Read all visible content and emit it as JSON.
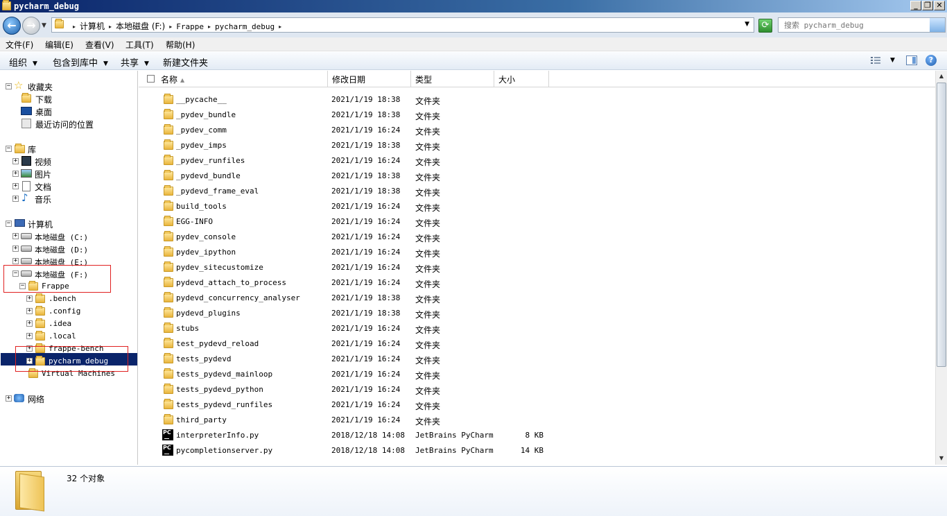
{
  "window": {
    "title": "pycharm_debug"
  },
  "address": {
    "crumbs": [
      "计算机",
      "本地磁盘 (F:)",
      "Frappe",
      "pycharm_debug"
    ],
    "search_placeholder": "搜索 pycharm_debug"
  },
  "menu": [
    "文件(F)",
    "编辑(E)",
    "查看(V)",
    "工具(T)",
    "帮助(H)"
  ],
  "toolbar": {
    "organize": "组织",
    "include": "包含到库中",
    "share": "共享",
    "new_folder": "新建文件夹"
  },
  "nav": {
    "favorites": "收藏夹",
    "downloads": "下载",
    "desktop": "桌面",
    "recent": "最近访问的位置",
    "libraries": "库",
    "videos": "视频",
    "pictures": "图片",
    "documents": "文档",
    "music": "音乐",
    "computer": "计算机",
    "drive_c": "本地磁盘 (C:)",
    "drive_d": "本地磁盘 (D:)",
    "drive_e": "本地磁盘 (E:)",
    "drive_f": "本地磁盘 (F:)",
    "frappe": "Frappe",
    "bench": ".bench",
    "config": ".config",
    "idea": ".idea",
    "local": ".local",
    "frappe_bench": "frappe-bench",
    "pycharm_debug": "pycharm_debug",
    "virtual_machines": "Virtual Machines",
    "network": "网络"
  },
  "columns": {
    "name": "名称",
    "modified": "修改日期",
    "type": "类型",
    "size": "大小"
  },
  "files": [
    {
      "name": "__pycache__",
      "date": "2021/1/19 18:38",
      "type": "文件夹",
      "size": ""
    },
    {
      "name": "_pydev_bundle",
      "date": "2021/1/19 18:38",
      "type": "文件夹",
      "size": ""
    },
    {
      "name": "_pydev_comm",
      "date": "2021/1/19 16:24",
      "type": "文件夹",
      "size": ""
    },
    {
      "name": "_pydev_imps",
      "date": "2021/1/19 18:38",
      "type": "文件夹",
      "size": ""
    },
    {
      "name": "_pydev_runfiles",
      "date": "2021/1/19 16:24",
      "type": "文件夹",
      "size": ""
    },
    {
      "name": "_pydevd_bundle",
      "date": "2021/1/19 18:38",
      "type": "文件夹",
      "size": ""
    },
    {
      "name": "_pydevd_frame_eval",
      "date": "2021/1/19 18:38",
      "type": "文件夹",
      "size": ""
    },
    {
      "name": "build_tools",
      "date": "2021/1/19 16:24",
      "type": "文件夹",
      "size": ""
    },
    {
      "name": "EGG-INFO",
      "date": "2021/1/19 16:24",
      "type": "文件夹",
      "size": ""
    },
    {
      "name": "pydev_console",
      "date": "2021/1/19 16:24",
      "type": "文件夹",
      "size": ""
    },
    {
      "name": "pydev_ipython",
      "date": "2021/1/19 16:24",
      "type": "文件夹",
      "size": ""
    },
    {
      "name": "pydev_sitecustomize",
      "date": "2021/1/19 16:24",
      "type": "文件夹",
      "size": ""
    },
    {
      "name": "pydevd_attach_to_process",
      "date": "2021/1/19 16:24",
      "type": "文件夹",
      "size": ""
    },
    {
      "name": "pydevd_concurrency_analyser",
      "date": "2021/1/19 18:38",
      "type": "文件夹",
      "size": ""
    },
    {
      "name": "pydevd_plugins",
      "date": "2021/1/19 18:38",
      "type": "文件夹",
      "size": ""
    },
    {
      "name": "stubs",
      "date": "2021/1/19 16:24",
      "type": "文件夹",
      "size": ""
    },
    {
      "name": "test_pydevd_reload",
      "date": "2021/1/19 16:24",
      "type": "文件夹",
      "size": ""
    },
    {
      "name": "tests_pydevd",
      "date": "2021/1/19 16:24",
      "type": "文件夹",
      "size": ""
    },
    {
      "name": "tests_pydevd_mainloop",
      "date": "2021/1/19 16:24",
      "type": "文件夹",
      "size": ""
    },
    {
      "name": "tests_pydevd_python",
      "date": "2021/1/19 16:24",
      "type": "文件夹",
      "size": ""
    },
    {
      "name": "tests_pydevd_runfiles",
      "date": "2021/1/19 16:24",
      "type": "文件夹",
      "size": ""
    },
    {
      "name": "third_party",
      "date": "2021/1/19 16:24",
      "type": "文件夹",
      "size": ""
    },
    {
      "name": "interpreterInfo.py",
      "date": "2018/12/18 14:08",
      "type": "JetBrains PyCharm",
      "size": "8 KB"
    },
    {
      "name": "pycompletionserver.py",
      "date": "2018/12/18 14:08",
      "type": "JetBrains PyCharm",
      "size": "14 KB"
    }
  ],
  "status": {
    "count": "32 个对象"
  },
  "colors": {
    "selection": "#0a246a",
    "highlight_box": "#e02020"
  }
}
